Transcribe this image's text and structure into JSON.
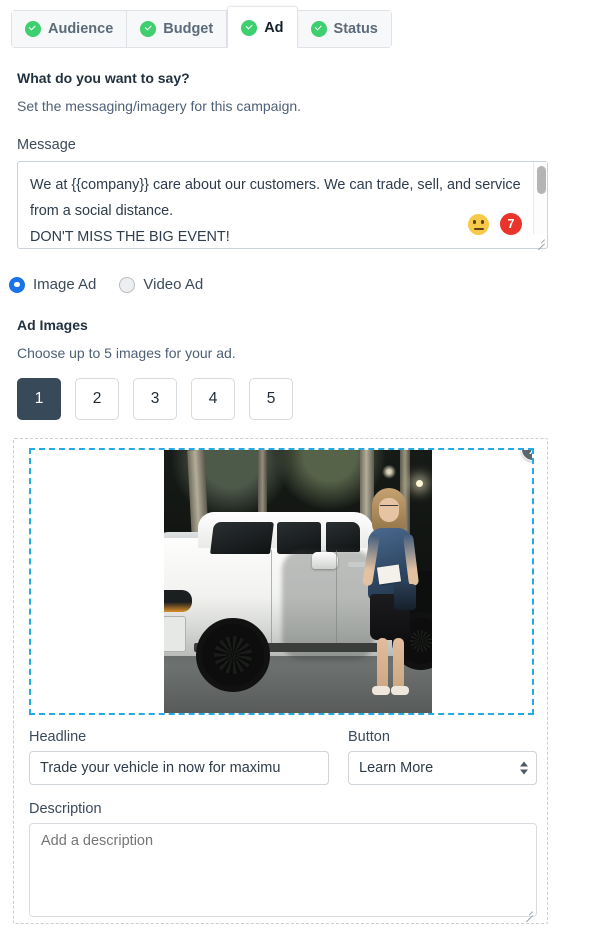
{
  "tabs": [
    {
      "label": "Audience",
      "active": false,
      "complete": true
    },
    {
      "label": "Budget",
      "active": false,
      "complete": true
    },
    {
      "label": "Ad",
      "active": true,
      "complete": true
    },
    {
      "label": "Status",
      "active": false,
      "complete": true
    }
  ],
  "section": {
    "title": "What do you want to say?",
    "subtitle": "Set the messaging/imagery for this campaign."
  },
  "message": {
    "label": "Message",
    "value": "We at {{company}} care about our customers. We can trade, sell, and service from a social distance.\nDON'T MISS THE BIG EVENT!",
    "emoji_icon": "neutral-face-emoji",
    "char_badge": "7"
  },
  "ad_type": {
    "options": [
      {
        "label": "Image Ad",
        "selected": true
      },
      {
        "label": "Video Ad",
        "selected": false
      }
    ]
  },
  "ad_images": {
    "title": "Ad Images",
    "subtitle": "Choose up to 5 images for your ad.",
    "slots": [
      {
        "label": "1",
        "active": true
      },
      {
        "label": "2",
        "active": false
      },
      {
        "label": "3",
        "active": false
      },
      {
        "label": "4",
        "active": false
      },
      {
        "label": "5",
        "active": false
      }
    ],
    "remove_label": "x"
  },
  "headline": {
    "label": "Headline",
    "value": "Trade your vehicle in now for maximu"
  },
  "button": {
    "label": "Button",
    "value": "Learn More"
  },
  "description": {
    "label": "Description",
    "value": "",
    "placeholder": "Add a description"
  },
  "colors": {
    "check_green": "#3ecf6e",
    "active_slot": "#38495a",
    "radio_blue": "#1a73e8",
    "dropzone_blue": "#25aae1",
    "badge_red": "#e8342a"
  }
}
